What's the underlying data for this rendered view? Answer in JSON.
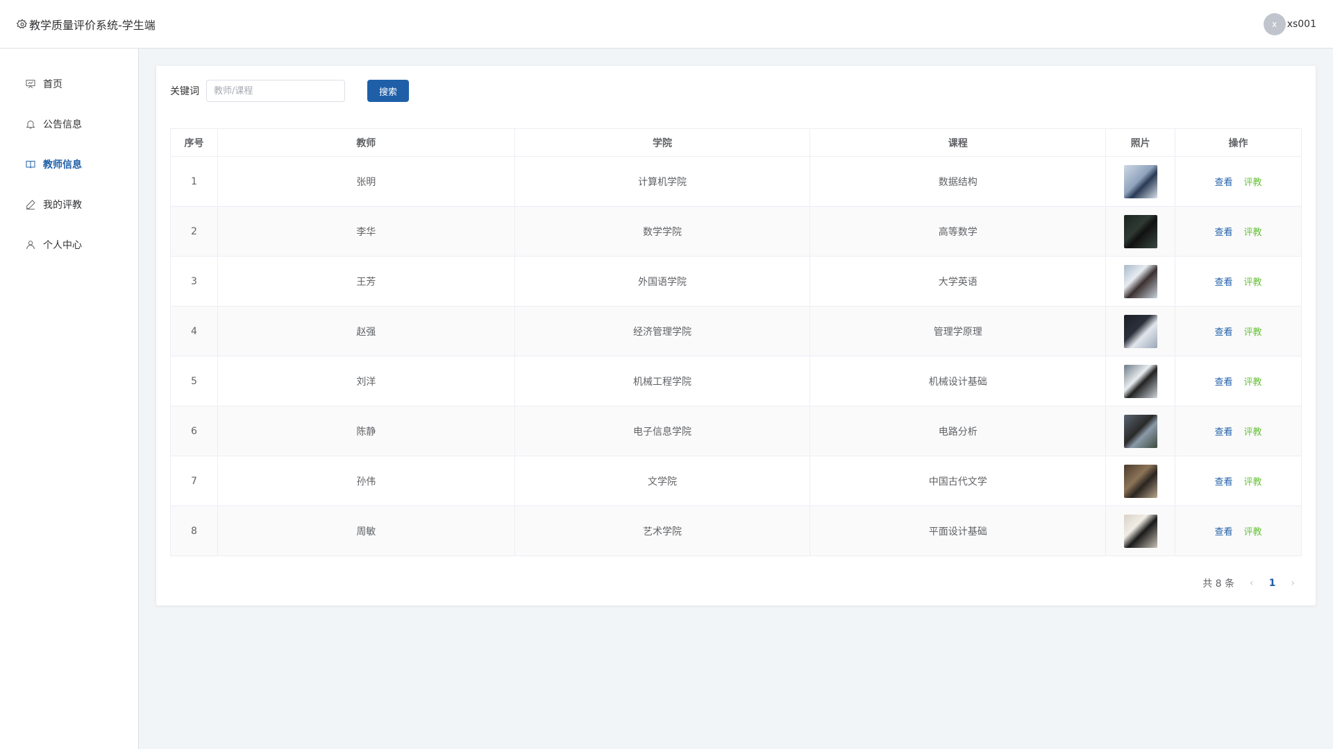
{
  "app": {
    "title": "教学质量评价系统-学生端"
  },
  "user": {
    "avatar_letter": "x",
    "name": "xs001"
  },
  "sidebar": {
    "items": [
      {
        "label": "首页",
        "icon": "presentation-icon"
      },
      {
        "label": "公告信息",
        "icon": "bell-icon"
      },
      {
        "label": "教师信息",
        "icon": "book-icon",
        "active": true
      },
      {
        "label": "我的评教",
        "icon": "pen-icon"
      },
      {
        "label": "个人中心",
        "icon": "user-icon"
      }
    ]
  },
  "search": {
    "label": "关键词",
    "placeholder": "教师/课程",
    "button": "搜索"
  },
  "table": {
    "headers": [
      "序号",
      "教师",
      "学院",
      "课程",
      "照片",
      "操作"
    ],
    "rows": [
      {
        "no": "1",
        "teacher": "张明",
        "college": "计算机学院",
        "course": "数据结构"
      },
      {
        "no": "2",
        "teacher": "李华",
        "college": "数学学院",
        "course": "高等数学"
      },
      {
        "no": "3",
        "teacher": "王芳",
        "college": "外国语学院",
        "course": "大学英语"
      },
      {
        "no": "4",
        "teacher": "赵强",
        "college": "经济管理学院",
        "course": "管理学原理"
      },
      {
        "no": "5",
        "teacher": "刘洋",
        "college": "机械工程学院",
        "course": "机械设计基础"
      },
      {
        "no": "6",
        "teacher": "陈静",
        "college": "电子信息学院",
        "course": "电路分析"
      },
      {
        "no": "7",
        "teacher": "孙伟",
        "college": "文学院",
        "course": "中国古代文学"
      },
      {
        "no": "8",
        "teacher": "周敏",
        "college": "艺术学院",
        "course": "平面设计基础"
      }
    ],
    "actions": {
      "view": "查看",
      "evaluate": "评教"
    }
  },
  "pagination": {
    "total_text": "共 8 条",
    "current_page": "1",
    "prev": "‹",
    "next": "›"
  },
  "colors": {
    "primary": "#1f5fa8",
    "evaluate": "#67c23a"
  }
}
